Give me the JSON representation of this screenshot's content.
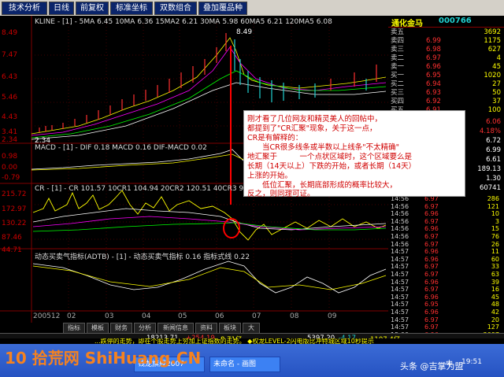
{
  "toolbar": {
    "tabs": [
      "技术分析",
      "日线",
      "前复权",
      "标准坐标",
      "双数组合",
      "叠加覆品种"
    ]
  },
  "chart": {
    "ma_header": "KLINE - [1] - 5MA 6.45 10MA 6.36 15MA2 6.21 30MA 5.98 60MA5 6.21 120MA5 6.08",
    "peak_label": "8.49",
    "low_label": "2.34",
    "y_prices": [
      "8.49",
      "7.47",
      "6.43",
      "5.46",
      "4.43",
      "3.41",
      "2.34"
    ],
    "macd_header": "MACD - [1] - DIF 0.18 MACD 0.16 DIF-MACD 0.02",
    "macd_y": [
      "0.98",
      "0.00",
      "-0.79"
    ],
    "cr_header": "CR - [1] - CR 101.57 10CR1 104.94 20CR2 120.51 40CR3 96.30",
    "cr_y": [
      "215.72",
      "172.97",
      "130.22",
      "87.46",
      "44.71"
    ],
    "sentiment_header": "动态买卖气指标(ADTB) - [1] - 动态买卖气指标 0.16 指标式线 0.22",
    "dates": [
      "200512",
      "02",
      "03",
      "04",
      "05",
      "06",
      "07",
      "08",
      "09"
    ]
  },
  "annotation": {
    "lines": [
      "刚才看了几位网友和精灵美人的回帖中，",
      "都提到了\"CR汇聚\"现象，关于这一点，",
      "CR是有解释的：",
      "　　当CR很多线条或半数以上线条\"不太精确\"",
      "地汇聚于　　　一个点状区域时，这个区域要么是",
      "长期（14天以上）下跌的开始，或者长期（14天）",
      "上涨的开始。",
      "　　低位汇聚，长期底部形成的概率比较大，",
      "反之，则同理可证。"
    ]
  },
  "stock_panel": {
    "title": "通化金马",
    "code": "000766",
    "orders": [
      {
        "label": "卖五",
        "price": "",
        "vol": "3692"
      },
      {
        "label": "卖四",
        "price": "6.99",
        "vol": "1175"
      },
      {
        "label": "卖三",
        "price": "6.98",
        "vol": "627"
      },
      {
        "label": "卖二",
        "price": "6.97",
        "vol": "4"
      },
      {
        "label": "卖一",
        "price": "6.96",
        "vol": "45"
      },
      {
        "label": "买一",
        "price": "6.95",
        "vol": "1020"
      },
      {
        "label": "买二",
        "price": "6.94",
        "vol": "27"
      },
      {
        "label": "买三",
        "price": "6.93",
        "vol": "50"
      },
      {
        "label": "买四",
        "price": "6.92",
        "vol": "37"
      },
      {
        "label": "买五",
        "price": "6.91",
        "vol": "100"
      }
    ],
    "stats": [
      "6.06",
      "4.18%",
      "6.72",
      "6.99",
      "6.61",
      "189.13",
      "1.30",
      "60741"
    ],
    "trades": [
      {
        "t": "14:56",
        "p": "6.97",
        "v": "286"
      },
      {
        "t": "14:56",
        "p": "6.97",
        "v": "121"
      },
      {
        "t": "14:56",
        "p": "6.96",
        "v": "10"
      },
      {
        "t": "14:56",
        "p": "6.97",
        "v": "3"
      },
      {
        "t": "14:56",
        "p": "6.96",
        "v": "15"
      },
      {
        "t": "14:56",
        "p": "6.97",
        "v": "76"
      },
      {
        "t": "14:56",
        "p": "6.97",
        "v": "26"
      },
      {
        "t": "14:57",
        "p": "6.96",
        "v": "11"
      },
      {
        "t": "14:57",
        "p": "6.96",
        "v": "60"
      },
      {
        "t": "14:57",
        "p": "6.97",
        "v": "33"
      },
      {
        "t": "14:57",
        "p": "6.97",
        "v": "63"
      },
      {
        "t": "14:57",
        "p": "6.96",
        "v": "39"
      },
      {
        "t": "14:57",
        "p": "6.97",
        "v": "16"
      },
      {
        "t": "14:57",
        "p": "6.96",
        "v": "45"
      },
      {
        "t": "14:57",
        "p": "6.95",
        "v": "48"
      },
      {
        "t": "14:57",
        "p": "6.96",
        "v": "42"
      },
      {
        "t": "14:57",
        "p": "6.97",
        "v": "20"
      },
      {
        "t": "14:57",
        "p": "6.97",
        "v": "127"
      },
      {
        "t": "15:00",
        "p": "6.96",
        "v": "2097"
      }
    ]
  },
  "bottom_tabs": [
    "指标",
    "模板",
    "财务",
    "分析",
    "新闻信息",
    "资料",
    "板块",
    "大"
  ],
  "ticker": {
    "text1": "18213.71",
    "text2": "+254.19",
    "text3": "8.71亿",
    "text4": "5397.20",
    "text5": "-4.17",
    "text6": "1107.4亿",
    "scroll": "...跌停的走势，即在个股走势上穷加上证指数的走势。 ◆权龙LEVEL-2闪电版比冲特城区域10秒提示"
  },
  "taskbar": {
    "tasks": [
      "钱龙旗舰2007",
      "未命名 - 画图"
    ],
    "clock": "19:51",
    "ime": "中",
    "watermark": "10 拾荒网 ShiHuang.CN",
    "credit": "头条 @吉掌为盟"
  },
  "colors": {
    "up": "#ff3030",
    "down": "#20d0d0",
    "text_red": "#d00000"
  }
}
